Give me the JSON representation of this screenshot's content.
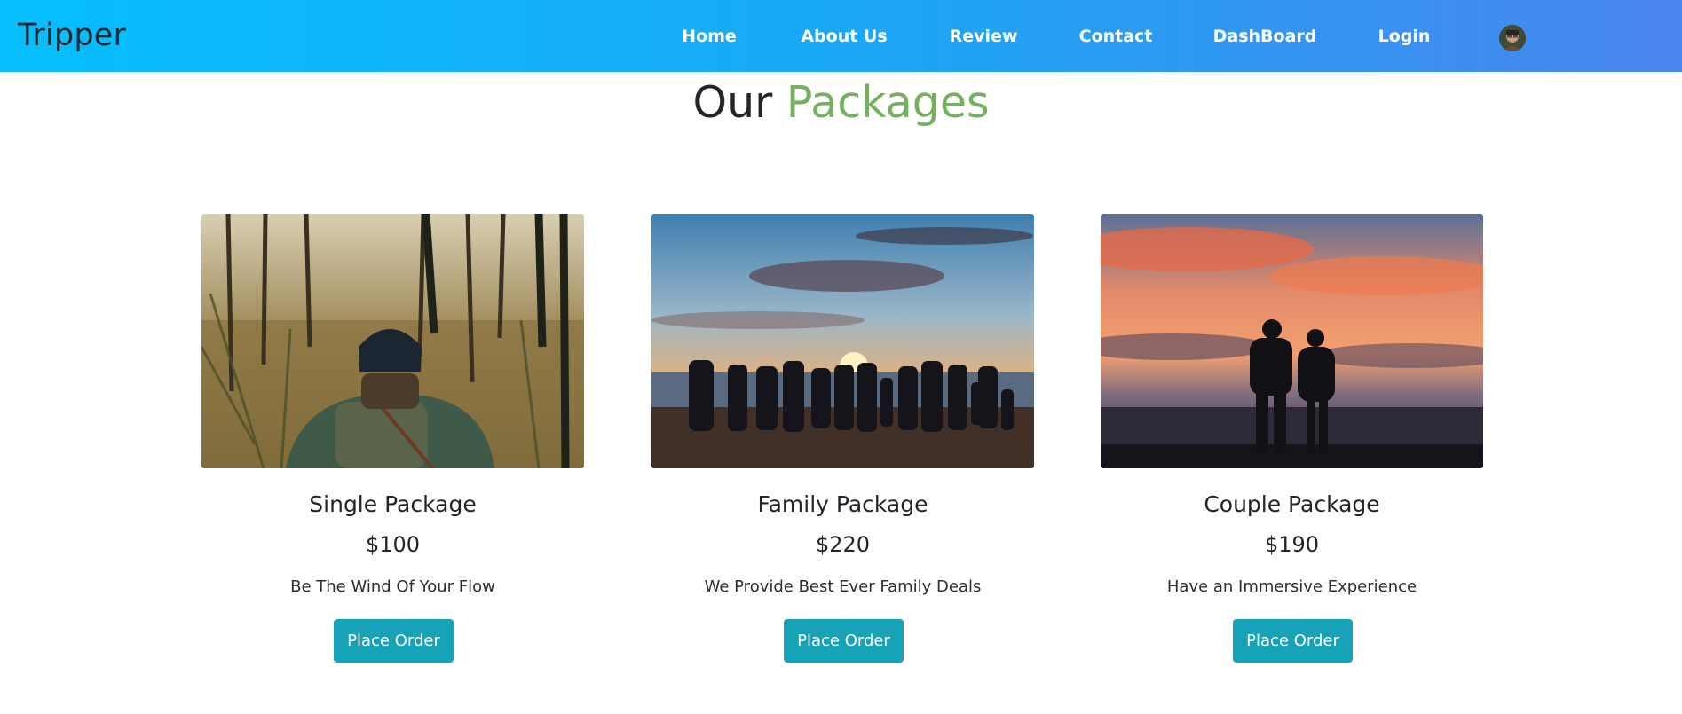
{
  "navbar": {
    "brand": "Tripper",
    "links": [
      {
        "label": "Home"
      },
      {
        "label": "About Us"
      },
      {
        "label": "Review"
      },
      {
        "label": "Contact"
      },
      {
        "label": "DashBoard"
      },
      {
        "label": "Login"
      }
    ],
    "avatar_icon": "user-avatar-photo"
  },
  "section": {
    "title_part1": "Our",
    "title_part2": "Packages"
  },
  "packages": [
    {
      "title": "Single Package",
      "price": "$100",
      "description": "Be The Wind Of Your Flow",
      "button": "Place Order",
      "image_subject": "hiker-in-forest-photo"
    },
    {
      "title": "Family Package",
      "price": "$220",
      "description": "We Provide Best Ever Family Deals",
      "button": "Place Order",
      "image_subject": "family-beach-sunset-photo"
    },
    {
      "title": "Couple Package",
      "price": "$190",
      "description": "Have an Immersive Experience",
      "button": "Place Order",
      "image_subject": "couple-sunset-photo"
    }
  ],
  "colors": {
    "accent_green": "#74b05d",
    "button_teal": "#17a2b8",
    "navbar_start": "#06bffc",
    "navbar_end": "#4a85ee"
  }
}
